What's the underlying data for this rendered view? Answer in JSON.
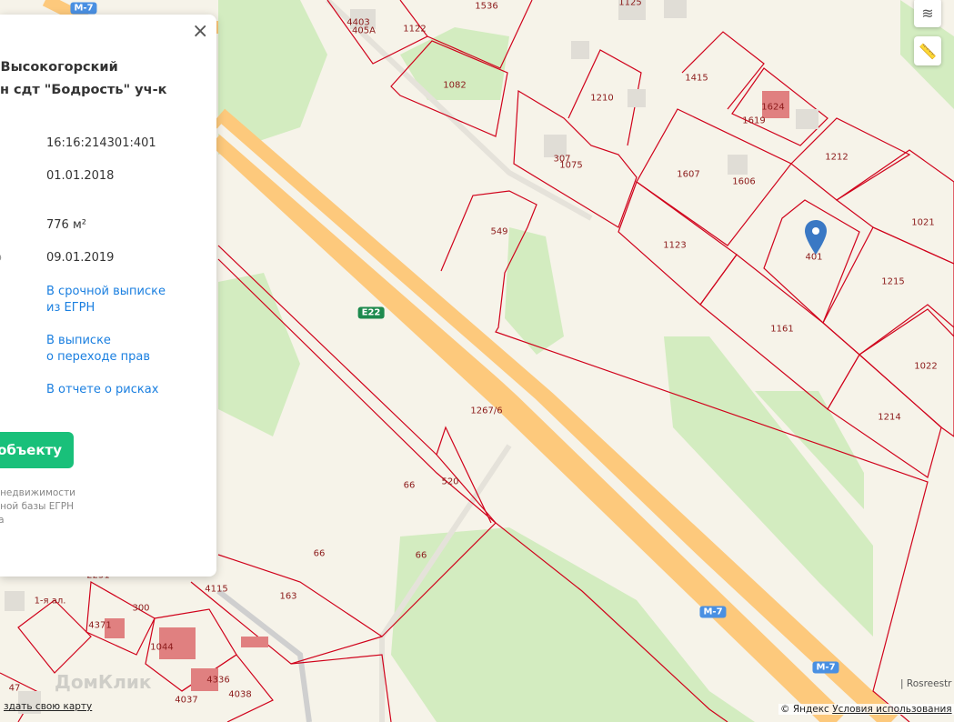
{
  "panel": {
    "close_label": "×",
    "title_line1": ", Высокогорский",
    "title_line2": "он сдт \"Бодрость\" уч-к",
    "fields": [
      {
        "label": "",
        "value": "16:16:214301:401"
      },
      {
        "label": "",
        "value": "01.01.2018"
      },
      {
        "label": "",
        "value": "776 м²"
      },
      {
        "label": "о",
        "value": "09.01.2019"
      }
    ],
    "links": [
      {
        "line1": "В срочной выписке",
        "line2": "из ЕГРН"
      },
      {
        "line1": "В выписке",
        "line2": "о переходе прав"
      },
      {
        "line1": "В отчете о рисках",
        "line2": ""
      }
    ],
    "button_label": "объекту",
    "note_lines": [
      "ений о недвижимости",
      "ициальной базы ЕГРН",
      "реестра"
    ]
  },
  "map": {
    "parcels": [
      "4403",
      "405A",
      "1122",
      "1536",
      "1125",
      "1082",
      "1415",
      "1210",
      "1619",
      "1624",
      "307",
      "1075",
      "1607",
      "1606",
      "1212",
      "549",
      "1123",
      "401",
      "1021",
      "1215",
      "1161",
      "1022",
      "1214",
      "1267/6",
      "66",
      "520",
      "66",
      "66",
      "163",
      "4115",
      "300",
      "4371",
      "1044",
      "4336",
      "4038",
      "4037",
      "47",
      "2251",
      "1-я ал."
    ],
    "road_shields": [
      "M-7",
      "E22",
      "M-7",
      "M-7"
    ],
    "colors": {
      "parcel": "#d0021b",
      "road": "#fdc97c",
      "green": "#d3ecc0",
      "shield_blue": "#4a90e2",
      "shield_green": "#1d8a4e",
      "button": "#19c07a",
      "link": "#1a7fe0"
    }
  },
  "controls": {
    "layers": "layers-icon",
    "ruler": "ruler-icon"
  },
  "attribution": {
    "rosreestr": "| Rosreestr",
    "yandex": "© Яндекс",
    "terms": "Условия использования",
    "create_map": "здать свою карту",
    "watermark": "ДомКлик"
  }
}
